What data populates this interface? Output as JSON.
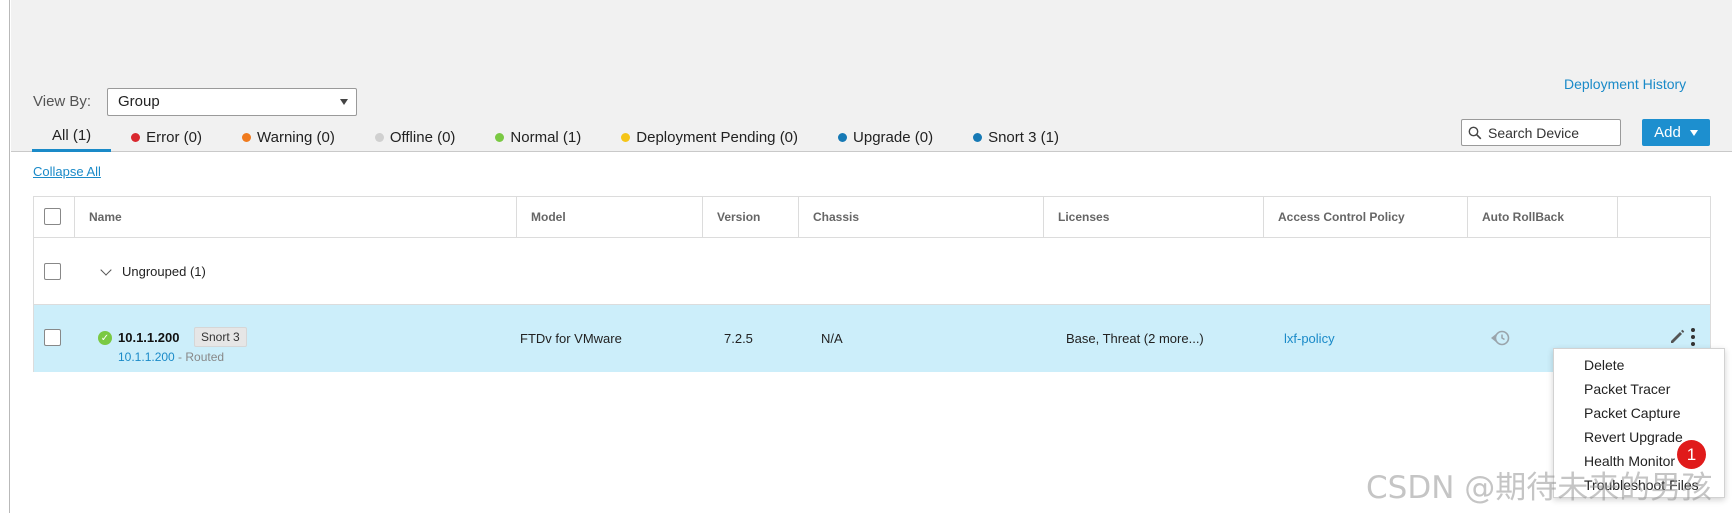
{
  "header": {
    "deployment_history": "Deployment History",
    "view_by_label": "View By:",
    "view_by_value": "Group",
    "search_placeholder": "Search Device",
    "add_label": "Add"
  },
  "tabs": [
    {
      "label": "All (1)",
      "color": "",
      "active": true
    },
    {
      "label": "Error (0)",
      "color": "#d9282f"
    },
    {
      "label": "Warning (0)",
      "color": "#f07b1e"
    },
    {
      "label": "Offline (0)",
      "color": "#d0d0d0"
    },
    {
      "label": "Normal (1)",
      "color": "#7ac943"
    },
    {
      "label": "Deployment Pending (0)",
      "color": "#f5c518"
    },
    {
      "label": "Upgrade (0)",
      "color": "#1679b5"
    },
    {
      "label": "Snort 3 (1)",
      "color": "#1679b5"
    }
  ],
  "collapse_all": "Collapse All",
  "table": {
    "columns": [
      "Name",
      "Model",
      "Version",
      "Chassis",
      "Licenses",
      "Access Control Policy",
      "Auto RollBack"
    ],
    "group": {
      "label": "Ungrouped (1)"
    },
    "device": {
      "name": "10.1.1.200",
      "badge": "Snort 3",
      "address": "10.1.1.200",
      "mode": " - Routed",
      "model": "FTDv for VMware",
      "version": "7.2.5",
      "chassis": "N/A",
      "licenses": "Base, Threat (2 more...)",
      "policy": "lxf-policy",
      "status": "normal"
    }
  },
  "menu": {
    "items": [
      "Delete",
      "Packet Tracer",
      "Packet Capture",
      "Revert Upgrade",
      "Health Monitor",
      "Troubleshoot Files"
    ]
  },
  "marker": "1",
  "watermark": "CSDN @期待未来的男孩",
  "colors": {
    "accent": "#1a8ac8",
    "selected_row": "#cceefa",
    "add_button": "#1d8fcf",
    "marker": "#e01b1b"
  }
}
